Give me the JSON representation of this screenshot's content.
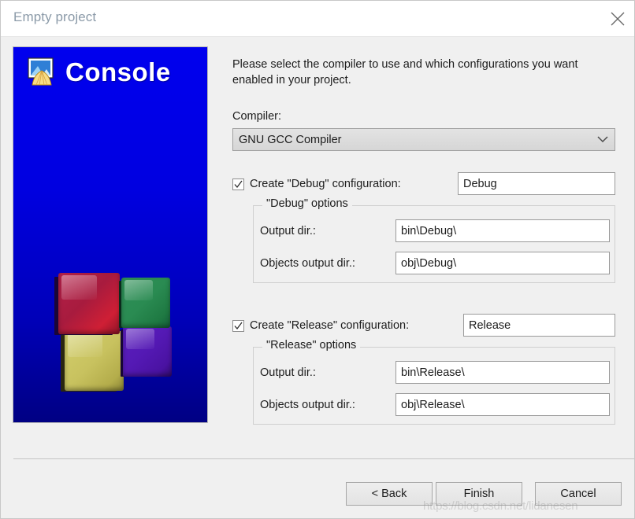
{
  "window": {
    "title": "Empty project",
    "close_icon": "close-icon"
  },
  "banner": {
    "title": "Console",
    "icon": "console-project-icon",
    "background_color": "#0000ee",
    "cubes": [
      {
        "name": "cube-red",
        "color": "#a81b3e"
      },
      {
        "name": "cube-green",
        "color": "#2a8b52"
      },
      {
        "name": "cube-yellow",
        "color": "#c8c25f"
      },
      {
        "name": "cube-purple",
        "color": "#5419b4"
      }
    ]
  },
  "main": {
    "intro": "Please select the compiler to use and which configurations you want enabled in your project.",
    "compiler_label": "Compiler:",
    "compiler_value": "GNU GCC Compiler",
    "compiler_arrow_icon": "chevron-down-icon",
    "debug": {
      "checkbox_label": "Create \"Debug\" configuration:",
      "checked": true,
      "name_value": "Debug",
      "group_legend": "\"Debug\" options",
      "output_dir_label": "Output dir.:",
      "output_dir_value": "bin\\Debug\\",
      "objects_dir_label": "Objects output dir.:",
      "objects_dir_value": "obj\\Debug\\"
    },
    "release": {
      "checkbox_label": "Create \"Release\" configuration:",
      "checked": true,
      "name_value": "Release",
      "group_legend": "\"Release\" options",
      "output_dir_label": "Output dir.:",
      "output_dir_value": "bin\\Release\\",
      "objects_dir_label": "Objects output dir.:",
      "objects_dir_value": "obj\\Release\\"
    }
  },
  "footer": {
    "back_label": "< Back",
    "finish_label": "Finish",
    "cancel_label": "Cancel"
  },
  "watermark": "https://blog.csdn.net/lidanesen"
}
